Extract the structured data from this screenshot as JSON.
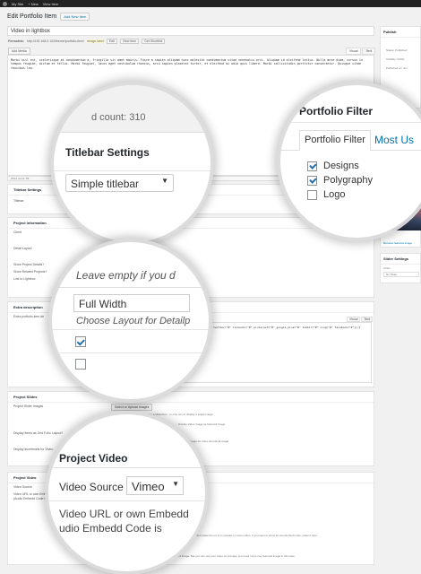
{
  "adminbar": {
    "items": [
      "My Site",
      "+ New",
      "View Item"
    ]
  },
  "page": {
    "title": "Edit Portfolio Item",
    "add_new": "Add New Item"
  },
  "post": {
    "title": "Video in lightbox",
    "permalink_label": "Permalink:",
    "permalink_url": "http://192.168.0.102/theme/portfolio-item/",
    "permalink_slug": "design-label",
    "edit_btn": "Edit",
    "view_btn": "View Item",
    "shortlink_btn": "Get Shortlink"
  },
  "editor": {
    "add_media": "Add Media",
    "tab_visual": "Visual",
    "tab_text": "Text",
    "content": "Morbi nisl est, scelerisque at condimentum a, fringilla sit amet mauris. Fusce a sapien aliquam nunc molestie condimentum vitae venenatis orci. Aliquam id eleifend lectus. Nulla ante diam, cursus in tempus feugiat, dictum et tellus. Morbi feugiat, lacus eget vestibulum rhoncus, arcu sapien placerat tortor, et eleifend mi odio quis libero. Morbi sollicitudin porttitor consectetur. Quisque vitae faucibus leo.",
    "word_count": "Word count: 56",
    "last_edited": "Last"
  },
  "zoom_word_count": "d count: 310",
  "titlebar": {
    "title": "Titlebar Settings",
    "label": "Titlebar",
    "value": "Simple titlebar"
  },
  "project_info": {
    "title": "Project Information",
    "fields": [
      {
        "label": "Client"
      },
      {
        "label": "Detail Layout",
        "value": "Full Width",
        "help": "Choose layout for Detailpage"
      },
      {
        "label": "Show Project Details?"
      },
      {
        "label": "Show Related Projects?"
      },
      {
        "label": "Link to Lightbox"
      }
    ],
    "client_help": "Leave empty if you don't want to show this.",
    "related_help": "Show Project Details & Related Posts"
  },
  "zoom_info": {
    "hint": "Leave empty if you d",
    "layout": "Full Width",
    "help": "Choose Layout for Detailp"
  },
  "extra": {
    "title": "Extra description",
    "label": "Extra portfolio item de",
    "tab_visual": "Visual",
    "tab_text": "Text",
    "content": "[share_buttons twitter=\"#\" linkedin=\"#\" pinterest=\"#\" google_plus=\"#\" tumblr=\"#\" xing=\"#\" facebook=\"#\"][/]"
  },
  "slides": {
    "title": "Project Slides",
    "label": "Project Slider Images",
    "button": "Select or Upload Images",
    "help": "Upload up to 20 project images for a slideshow - or only one to display a single image.",
    "label2": "Display Items as Grid Folio Layout?",
    "help2": "Display slides image as featured image",
    "label3": "Display thumbnails for Video",
    "help3": "Featured image for video thumbnail image"
  },
  "video": {
    "title": "Project Video",
    "source_label": "Video Source",
    "source_value": "Vimeo",
    "url_label": "Video URL or own Embedd Code (Audio Embedd Code is",
    "help": "Just paste the url of a youtube or vimeo video. If you want to show an own Embed Code, paste it here.",
    "notice": "Notice: The Preview Image will be the Image set as Featured Image. But you can see your video on preview, you need not to use featured image in this case."
  },
  "zoom_video": {
    "title": "Project Video",
    "source_label": "Video Source",
    "source_value": "Vimeo",
    "url_line1": "Video URL or own Embedd",
    "url_line2": "udio Embedd Code is"
  },
  "publish": {
    "title": "Publish",
    "status": "Status: Published",
    "visibility": "Visibility: Public",
    "published": "Published on: Jun",
    "trash": "Move to Trash"
  },
  "portfolio_filter": {
    "title": "Portfolio Filter",
    "tab_all": "Portfolio Filter",
    "tab_most": "Most U"
  },
  "zoom_filter": {
    "title": "Portfolio Filter",
    "tab_all": "Portfolio Filter",
    "tab_most": "Most Us",
    "items": [
      {
        "label": "Designs",
        "checked": true
      },
      {
        "label": "Polygraphy",
        "checked": true
      },
      {
        "label": "Logo",
        "checked": false
      }
    ]
  },
  "featured": {
    "remove": "Remove featured image"
  },
  "slider_settings": {
    "title": "Slider Settings",
    "order_label": "Order",
    "order_value": "No Slider"
  }
}
